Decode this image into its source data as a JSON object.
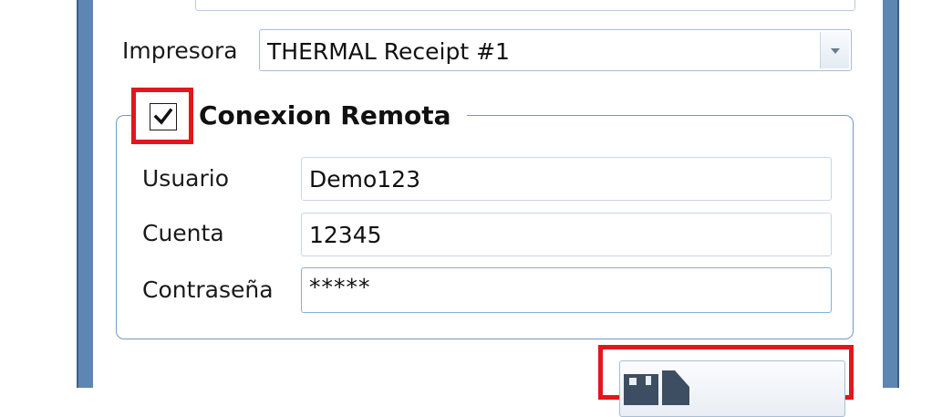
{
  "printer": {
    "label": "Impresora",
    "selected": "THERMAL Receipt #1"
  },
  "remote_connection": {
    "title": "Conexion Remota",
    "enabled": true,
    "user_label": "Usuario",
    "user_value": "Demo123",
    "account_label": "Cuenta",
    "account_value": "12345",
    "password_label": "Contraseña",
    "password_value": "*****"
  },
  "save_button": {
    "icon": "floppy-disk-icon"
  },
  "colors": {
    "window_border": "#5e86b3",
    "group_border": "#6f9ac6",
    "highlight": "#e3161c"
  }
}
